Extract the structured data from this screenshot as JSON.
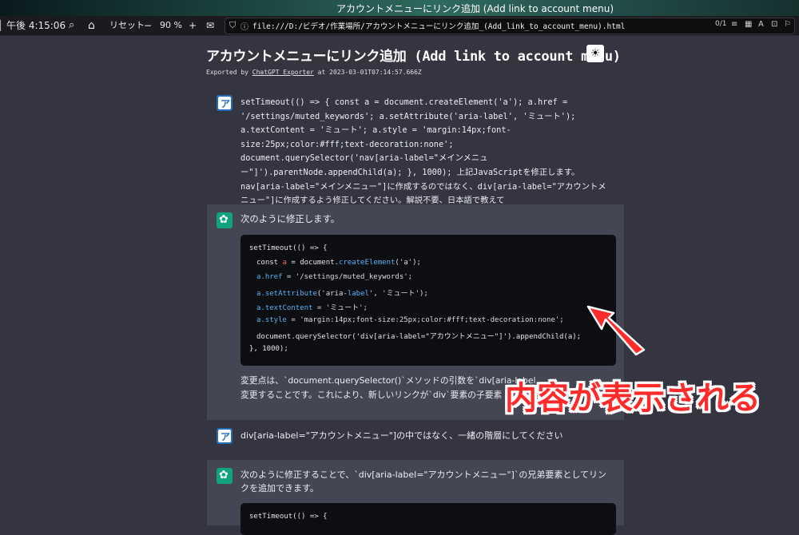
{
  "window": {
    "title": "アカウントメニューにリンク追加 (Add link to account menu)"
  },
  "toolbar": {
    "clock": "午後 4:15:06",
    "reset_label": "リセット",
    "zoom_minus": "−",
    "zoom_value": "90 %",
    "zoom_plus": "+",
    "url": "file:///D:/ビデオ/作業場所/アカウントメニューにリンク追加_(Add_link_to_account_menu).html",
    "page_count": "0/1"
  },
  "page": {
    "title": "アカウントメニューにリンク追加 (Add link to account menu)",
    "export_prefix": "Exported by ",
    "export_link": "ChatGPT Exporter",
    "export_suffix": " at 2023-03-01T07:14:57.666Z"
  },
  "messages": [
    {
      "role": "user",
      "text": "setTimeout(() => { const a = document.createElement('a'); a.href = '/settings/muted_keywords'; a.setAttribute('aria-label', 'ミュート'); a.textContent = 'ミュート'; a.style = 'margin:14px;font-size:25px;color:#fff;text-decoration:none'; document.querySelector('nav[aria-label=\"メインメニュー\"]').parentNode.appendChild(a); }, 1000); 上記JavaScriptを修正します。nav[aria-label=\"メインメニュー\"]に作成するのではなく、div[aria-label=\"アカウントメニュー\"]に作成するよう修正してください。解説不要、日本語で教えて"
    },
    {
      "role": "assistant",
      "intro": "次のように修正します。",
      "code": {
        "l1": "setTimeout(() => {",
        "l2a": "const ",
        "l2b": "a",
        "l2c": " = document.",
        "l2d": "createElement",
        "l2e": "('a');",
        "l3a": "a",
        "l3b": ".href",
        "l3c": " = '/settings/muted_keywords';",
        "l4a": "a",
        "l4b": ".setAttribute",
        "l4c": "('aria-",
        "l4d": "label",
        "l4e": "', 'ミュート');",
        "l5a": "a",
        "l5b": ".textContent",
        "l5c": " = 'ミュート';",
        "l6a": "a",
        "l6b": ".style",
        "l6c": " = 'margin:14px;font-size:25px;color:#fff;text-decoration:none';",
        "l7": "document.querySelector('div[aria-label=\"アカウントメニュー\"]').appendChild(a);",
        "l8": "}, 1000);"
      },
      "outro1": "変更点は、`document.querySelector()`メソッドの引数を`div[aria-label",
      "outro2": "変更することです。これにより、新しいリンクが`div`要素の子要素"
    },
    {
      "role": "user",
      "text": "div[aria-label=\"アカウントメニュー\"]の中ではなく、一緒の階層にしてください"
    },
    {
      "role": "assistant",
      "intro": "次のように修正することで、`div[aria-label=\"アカウントメニュー\"]`の兄弟要素としてリンクを追加できます。",
      "code_first_line": "setTimeout(() => {"
    }
  ],
  "annotation": {
    "text": "内容が表示される",
    "color": "#ff2a2a"
  }
}
